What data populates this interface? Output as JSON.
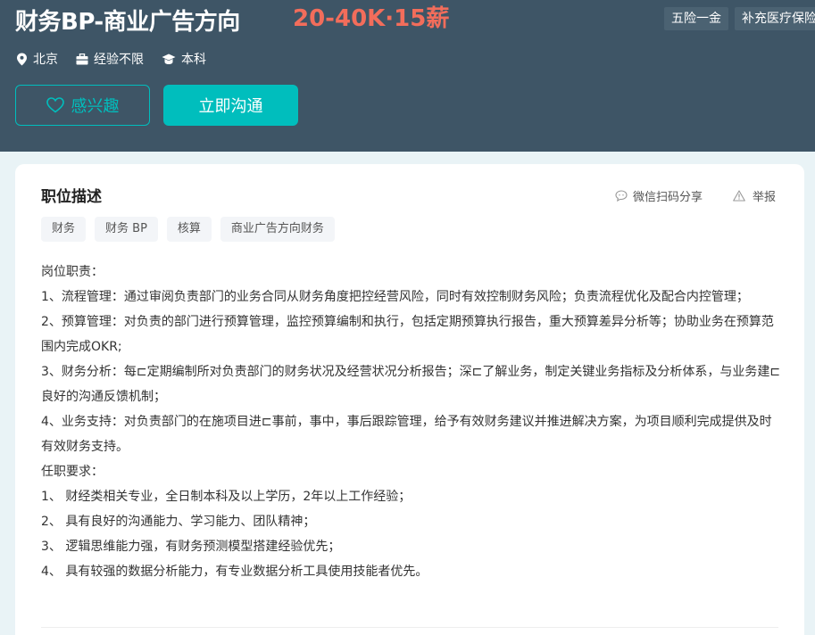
{
  "header": {
    "title": "财务BP-商业广告方向",
    "salary": "20-40K·15薪",
    "benefits": [
      "五险一金",
      "补充医疗保险"
    ],
    "meta": {
      "location": "北京",
      "experience": "经验不限",
      "education": "本科"
    },
    "buttons": {
      "interest": "感兴趣",
      "chat": "立即沟通"
    }
  },
  "job": {
    "section_title": "职位描述",
    "share_label": "微信扫码分享",
    "report_label": "举报",
    "tags": [
      "财务",
      "财务 BP",
      "核算",
      "商业广告方向财务"
    ],
    "description": [
      "岗位职责：",
      "1、流程管理：通过审阅负责部门的业务合同从财务角度把控经营风险，同时有效控制财务风险；负责流程优化及配合内控管理；",
      "2、预算管理：对负责的部门进行预算管理，监控预算编制和执行，包括定期预算执行报告，重大预算差异分析等；协助业务在预算范围内完成OKR;",
      "3、财务分析：每⊏定期编制所对负责部门的财务状况及经营状况分析报告；深⊏了解业务，制定关键业务指标及分析体系，与业务建⊏良好的沟通反馈机制；",
      "4、业务支持：对负责部门的在施项目进⊏事前，事中，事后跟踪管理，给予有效财务建议并推进解决方案，为项目顺利完成提供及时有效财务支持。",
      "任职要求：",
      "1、  财经类相关专业，全日制本科及以上学历，2年以上工作经验；",
      "2、  具有良好的沟通能力、学习能力、团队精神；",
      "3、  逻辑思维能力强，有财务预测模型搭建经验优先；",
      "4、  具有较强的数据分析能力，有专业数据分析工具使用技能者优先。"
    ]
  },
  "colors": {
    "header_bg": "#3e5566",
    "accent": "#00bebd",
    "salary": "#f26d5b"
  }
}
